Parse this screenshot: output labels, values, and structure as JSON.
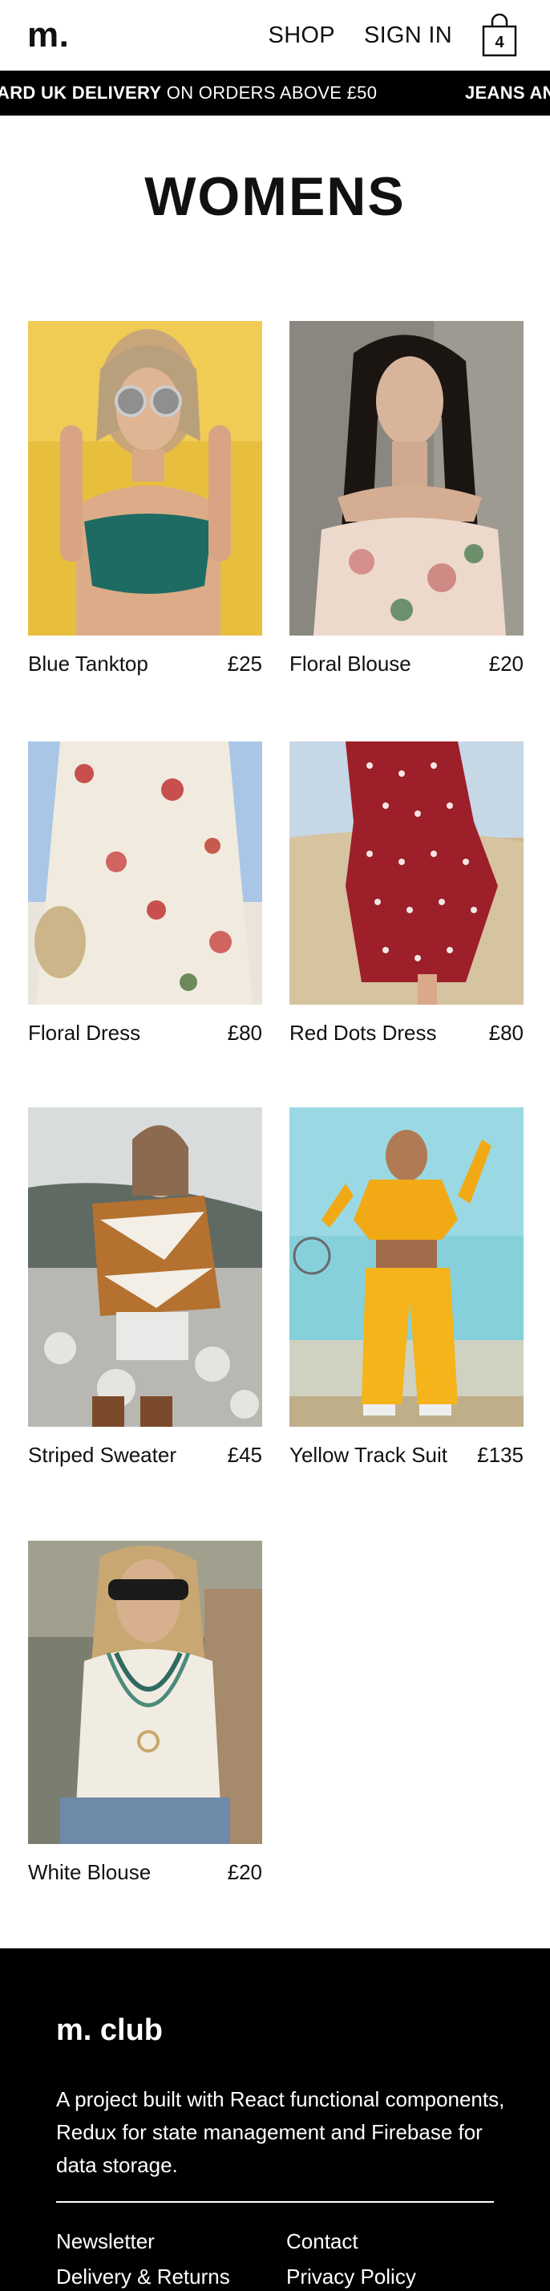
{
  "header": {
    "logo": "m.",
    "nav": {
      "shop": "SHOP",
      "sign_in": "SIGN IN"
    },
    "cart_count": "4"
  },
  "promo": {
    "item1_bold": "ARD UK DELIVERY",
    "item1_rest": " ON ORDERS ABOVE £50",
    "item2_bold": "JEANS AN"
  },
  "page_title": "WOMENS",
  "products": [
    {
      "name": "Blue Tanktop",
      "price": "£25"
    },
    {
      "name": "Floral Blouse",
      "price": "£20"
    },
    {
      "name": "Floral Dress",
      "price": "£80"
    },
    {
      "name": "Red Dots Dress",
      "price": "£80"
    },
    {
      "name": "Striped Sweater",
      "price": "£45"
    },
    {
      "name": "Yellow Track Suit",
      "price": "£135"
    },
    {
      "name": "White Blouse",
      "price": "£20"
    }
  ],
  "footer": {
    "brand": "m. club",
    "description": "A project built with React functional components, Redux for state management and Firebase for data storage.",
    "links": {
      "newsletter": "Newsletter",
      "contact": "Contact",
      "delivery": "Delivery & Returns",
      "privacy": "Privacy Policy"
    }
  },
  "colors": {
    "bar_bg": "#000000",
    "text": "#111111",
    "background": "#ffffff"
  }
}
